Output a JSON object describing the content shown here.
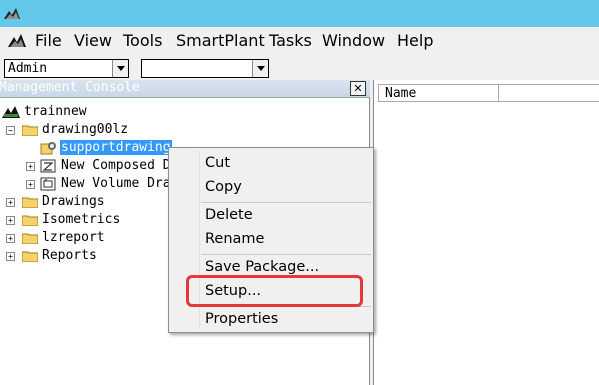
{
  "menu": {
    "items": [
      "File",
      "View",
      "Tools",
      "SmartPlant",
      "Tasks",
      "Window",
      "Help"
    ]
  },
  "toolbar": {
    "user_combo_value": "Admin",
    "second_combo_value": ""
  },
  "console": {
    "title": "Management Console",
    "close_label": "✕",
    "tree": {
      "root": "trainnew",
      "drawing_folder": "drawing00lz",
      "selected_item": "supportdrawing",
      "composed_item": "New Composed D",
      "volume_item": "New Volume Dra",
      "folders": [
        "Drawings",
        "Isometrics",
        "lzreport",
        "Reports"
      ]
    }
  },
  "list_pane": {
    "columns": [
      "Name"
    ]
  },
  "context_menu": {
    "items": [
      "Cut",
      "Copy",
      "Delete",
      "Rename",
      "Save Package...",
      "Setup...",
      "Properties"
    ],
    "highlighted": "Setup..."
  },
  "colors": {
    "titlebar": "#63c8ea",
    "selection": "#3399ff",
    "highlight_box": "#e53935"
  }
}
